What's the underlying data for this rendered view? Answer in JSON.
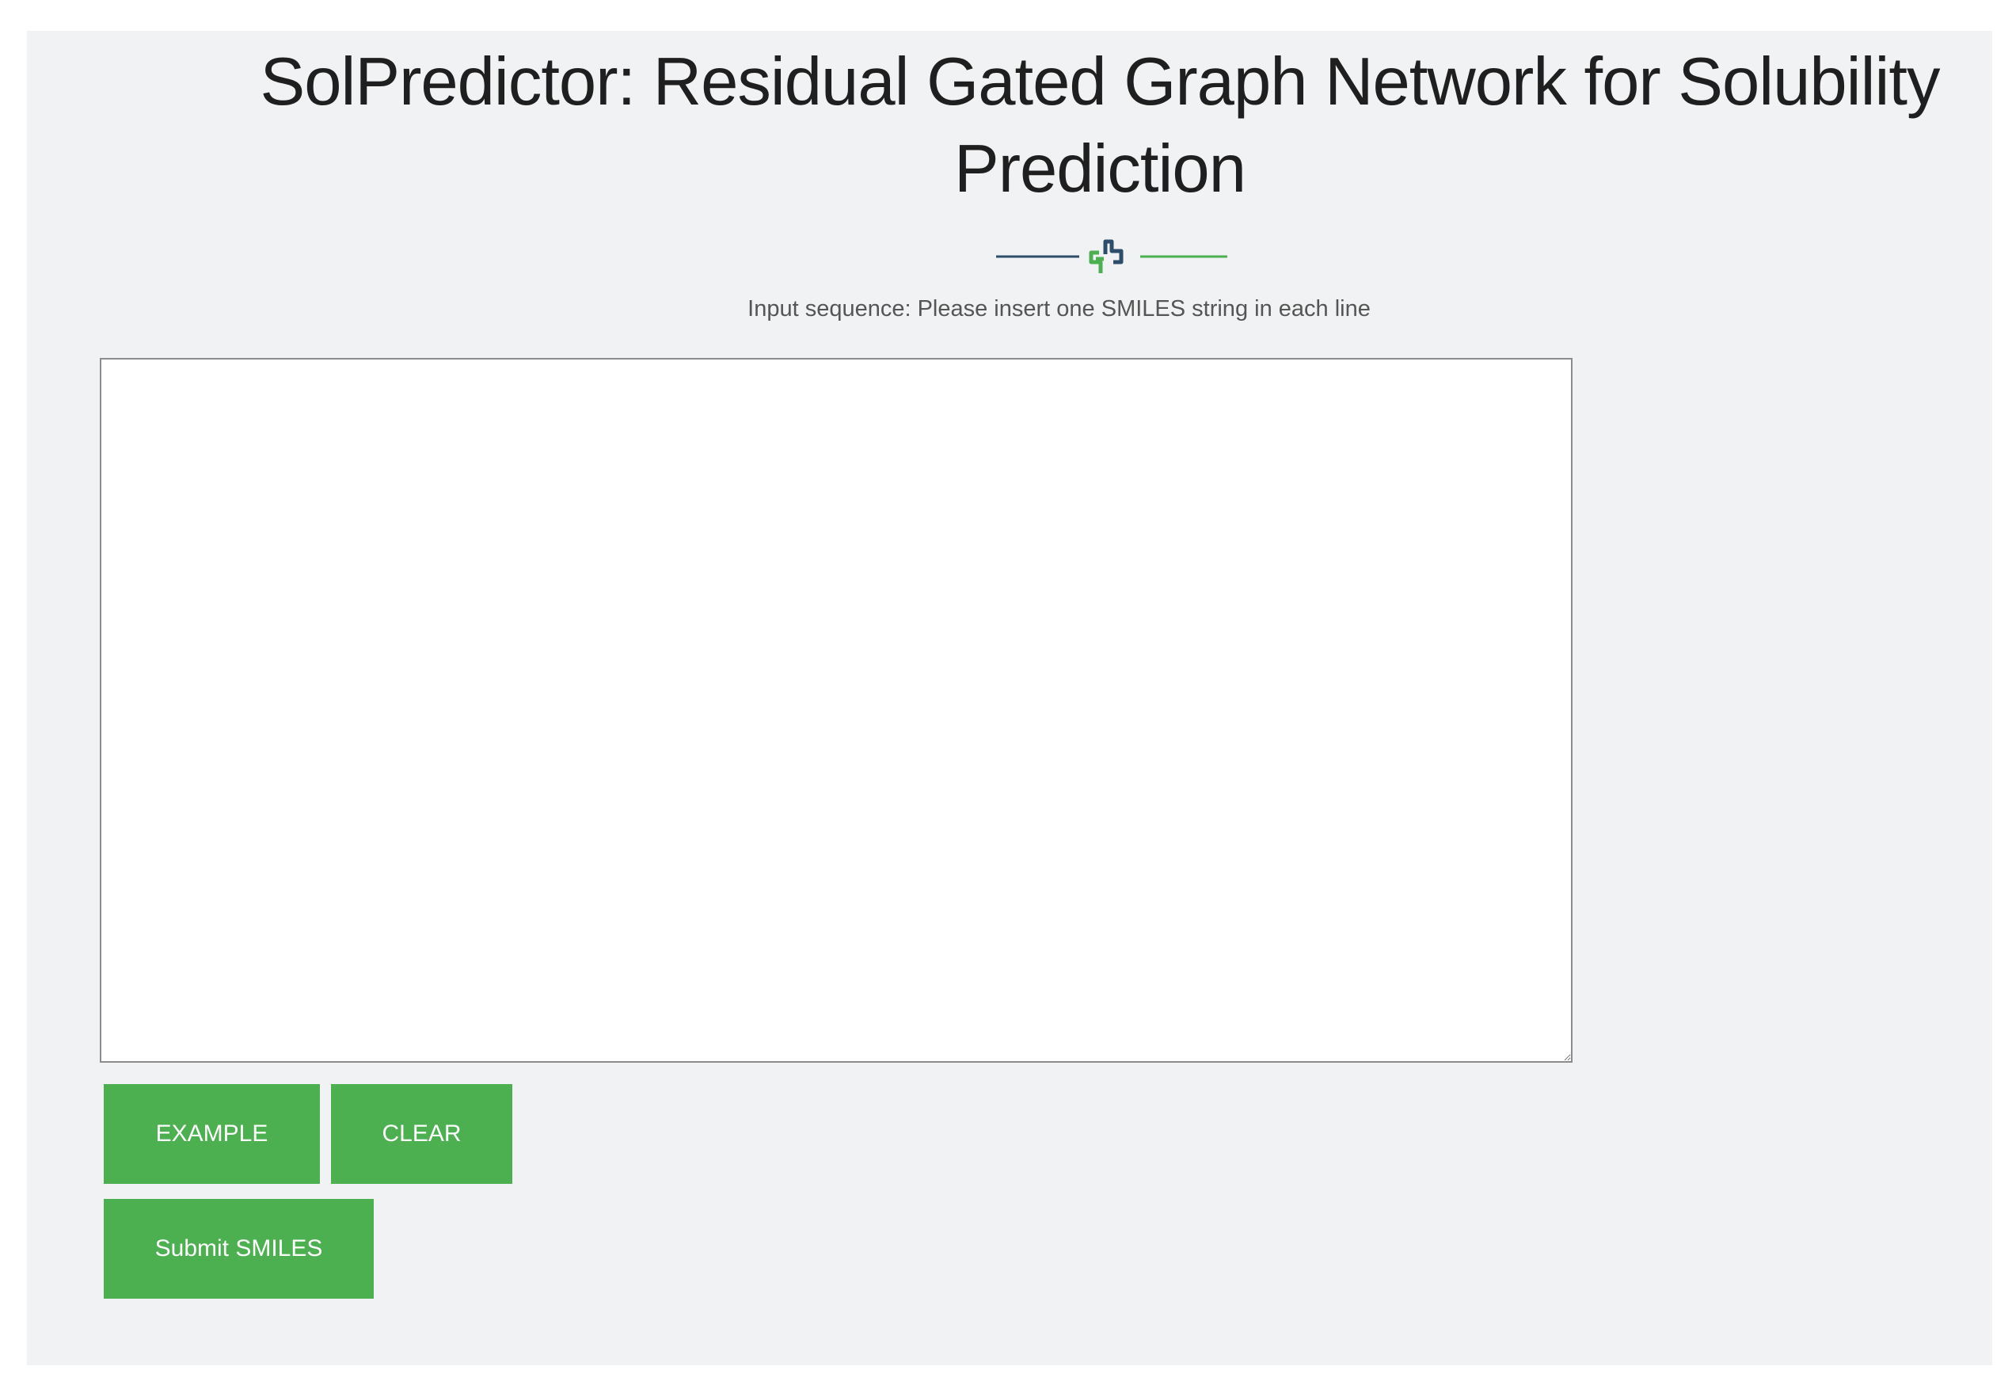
{
  "header": {
    "title": "SolPredictor: Residual Gated Graph Network for Solubility Prediction",
    "divider_icon": "molecule-link-icon"
  },
  "form": {
    "instructions": "Input sequence: Please insert one SMILES string in each line",
    "input_value": "",
    "example_label": "EXAMPLE",
    "clear_label": "CLEAR",
    "submit_label": "Submit SMILES"
  },
  "colors": {
    "background": "#f1f2f3",
    "button": "#4caf50",
    "divider_left": "#2e4d6b",
    "divider_right": "#4caf50"
  }
}
